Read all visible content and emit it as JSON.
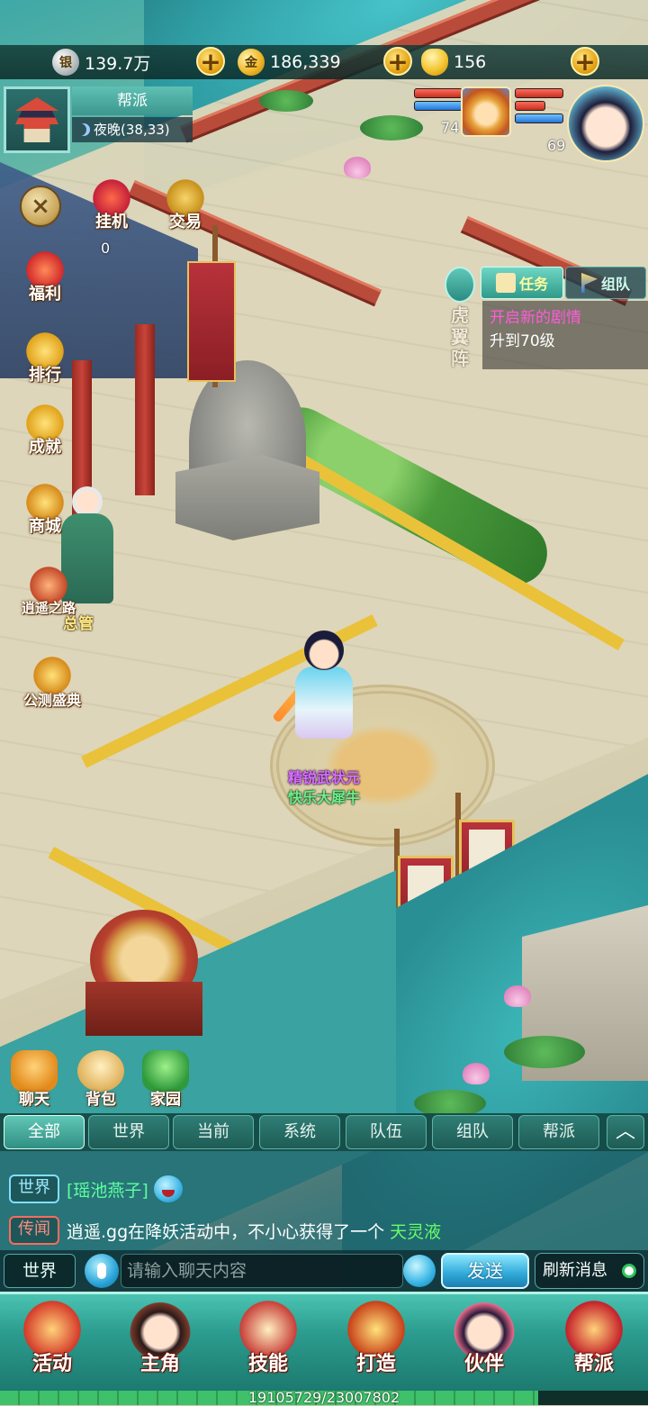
{
  "currency": {
    "silver": "139.7万",
    "gold": "186,339",
    "ingot": "156",
    "silver_icon": "silver-coin-icon",
    "gold_icon": "gold-coin-icon",
    "ingot_icon": "gold-ingot-icon"
  },
  "guild": {
    "title": "帮派",
    "time_location": "夜晚(38,33)"
  },
  "party": [
    {
      "level": "74",
      "icon": "monkey-pet-portrait"
    },
    {
      "level": "69",
      "icon": "player-portrait"
    }
  ],
  "left_menu": {
    "close_symbol": "×",
    "afk": "挂机",
    "afk_count": "0",
    "trade": "交易",
    "welfare": "福利",
    "ranking": "排行",
    "achievement": "成就",
    "shop": "商城",
    "xiaoyao_road": "逍遥之路",
    "beta_festival": "公测盛典"
  },
  "scene": {
    "npc_name": "总管",
    "formation_name": "虎翼阵",
    "player_title": "精锐武状元",
    "player_name": "快乐大犀牛"
  },
  "tasks": {
    "tab_task": "任务",
    "tab_team": "组队",
    "task_line1": "开启新的剧情",
    "task_line2": "升到70级"
  },
  "quick_buttons": {
    "chat": "聊天",
    "bag": "背包",
    "home": "家园"
  },
  "chat_tabs": [
    "全部",
    "世界",
    "当前",
    "系统",
    "队伍",
    "组队",
    "帮派"
  ],
  "chat_messages": {
    "m1_channel": "世界",
    "m1_user": "[瑶池燕子]",
    "m2_channel": "传闻",
    "m2_text": "逍遥.gg在降妖活动中，不小心获得了一个",
    "m2_item": "天灵液"
  },
  "chat_input": {
    "channel": "世界",
    "placeholder": "请输入聊天内容",
    "send": "发送",
    "refresh": "刷新消息"
  },
  "bottom_nav": [
    "活动",
    "主角",
    "技能",
    "打造",
    "伙伴",
    "帮派"
  ],
  "experience": {
    "text": "19105729/23007802",
    "fraction": 0.8304
  },
  "colors": {
    "accent_teal": "#2b9c8e",
    "task_highlight": "#ff5bd8",
    "player_title": "#d86fff",
    "player_name": "#6cf08a",
    "item_green": "#66ff66"
  }
}
